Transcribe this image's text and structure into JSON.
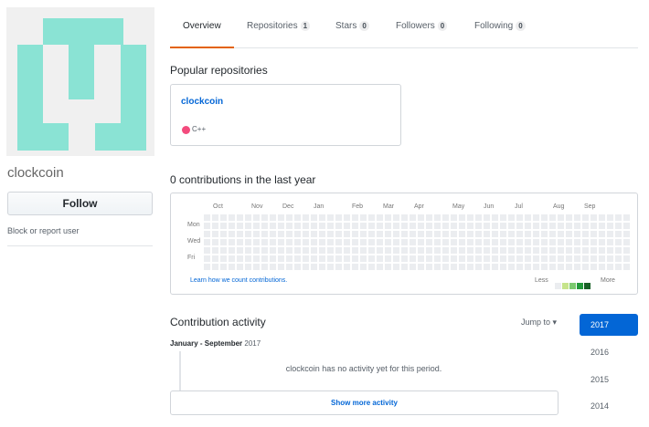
{
  "profile": {
    "username": "clockcoin",
    "follow_label": "Follow",
    "block_label": "Block or report user",
    "avatar_color": "#8ae3d4"
  },
  "tabs": [
    {
      "label": "Overview",
      "count": null,
      "selected": true
    },
    {
      "label": "Repositories",
      "count": "1",
      "selected": false
    },
    {
      "label": "Stars",
      "count": "0",
      "selected": false
    },
    {
      "label": "Followers",
      "count": "0",
      "selected": false
    },
    {
      "label": "Following",
      "count": "0",
      "selected": false
    }
  ],
  "popular": {
    "title": "Popular repositories",
    "repos": [
      {
        "name": "clockcoin",
        "language": "C++",
        "language_color": "#f34b7d"
      }
    ]
  },
  "contributions": {
    "title": "0 contributions in the last year",
    "months": [
      "Oct",
      "Nov",
      "Dec",
      "Jan",
      "Feb",
      "Mar",
      "Apr",
      "May",
      "Jun",
      "Jul",
      "Aug",
      "Sep"
    ],
    "days": [
      "Mon",
      "Wed",
      "Fri"
    ],
    "learn_label": "Learn how we count contributions.",
    "legend_less": "Less",
    "legend_more": "More",
    "legend_colors": [
      "#ebedf0",
      "#c6e48b",
      "#7bc96f",
      "#239a3b",
      "#196127"
    ],
    "empty_color": "#ebedf0",
    "total": 0
  },
  "activity": {
    "title": "Contribution activity",
    "jump_to": "Jump to",
    "period_month": "January - September",
    "period_year": "2017",
    "no_activity": "clockcoin has no activity yet for this period.",
    "show_more": "Show more activity"
  },
  "years": [
    {
      "label": "2017",
      "active": true
    },
    {
      "label": "2016",
      "active": false
    },
    {
      "label": "2015",
      "active": false
    },
    {
      "label": "2014",
      "active": false
    }
  ],
  "colors": {
    "accent": "#0366d6",
    "tab_underline": "#e36209"
  }
}
